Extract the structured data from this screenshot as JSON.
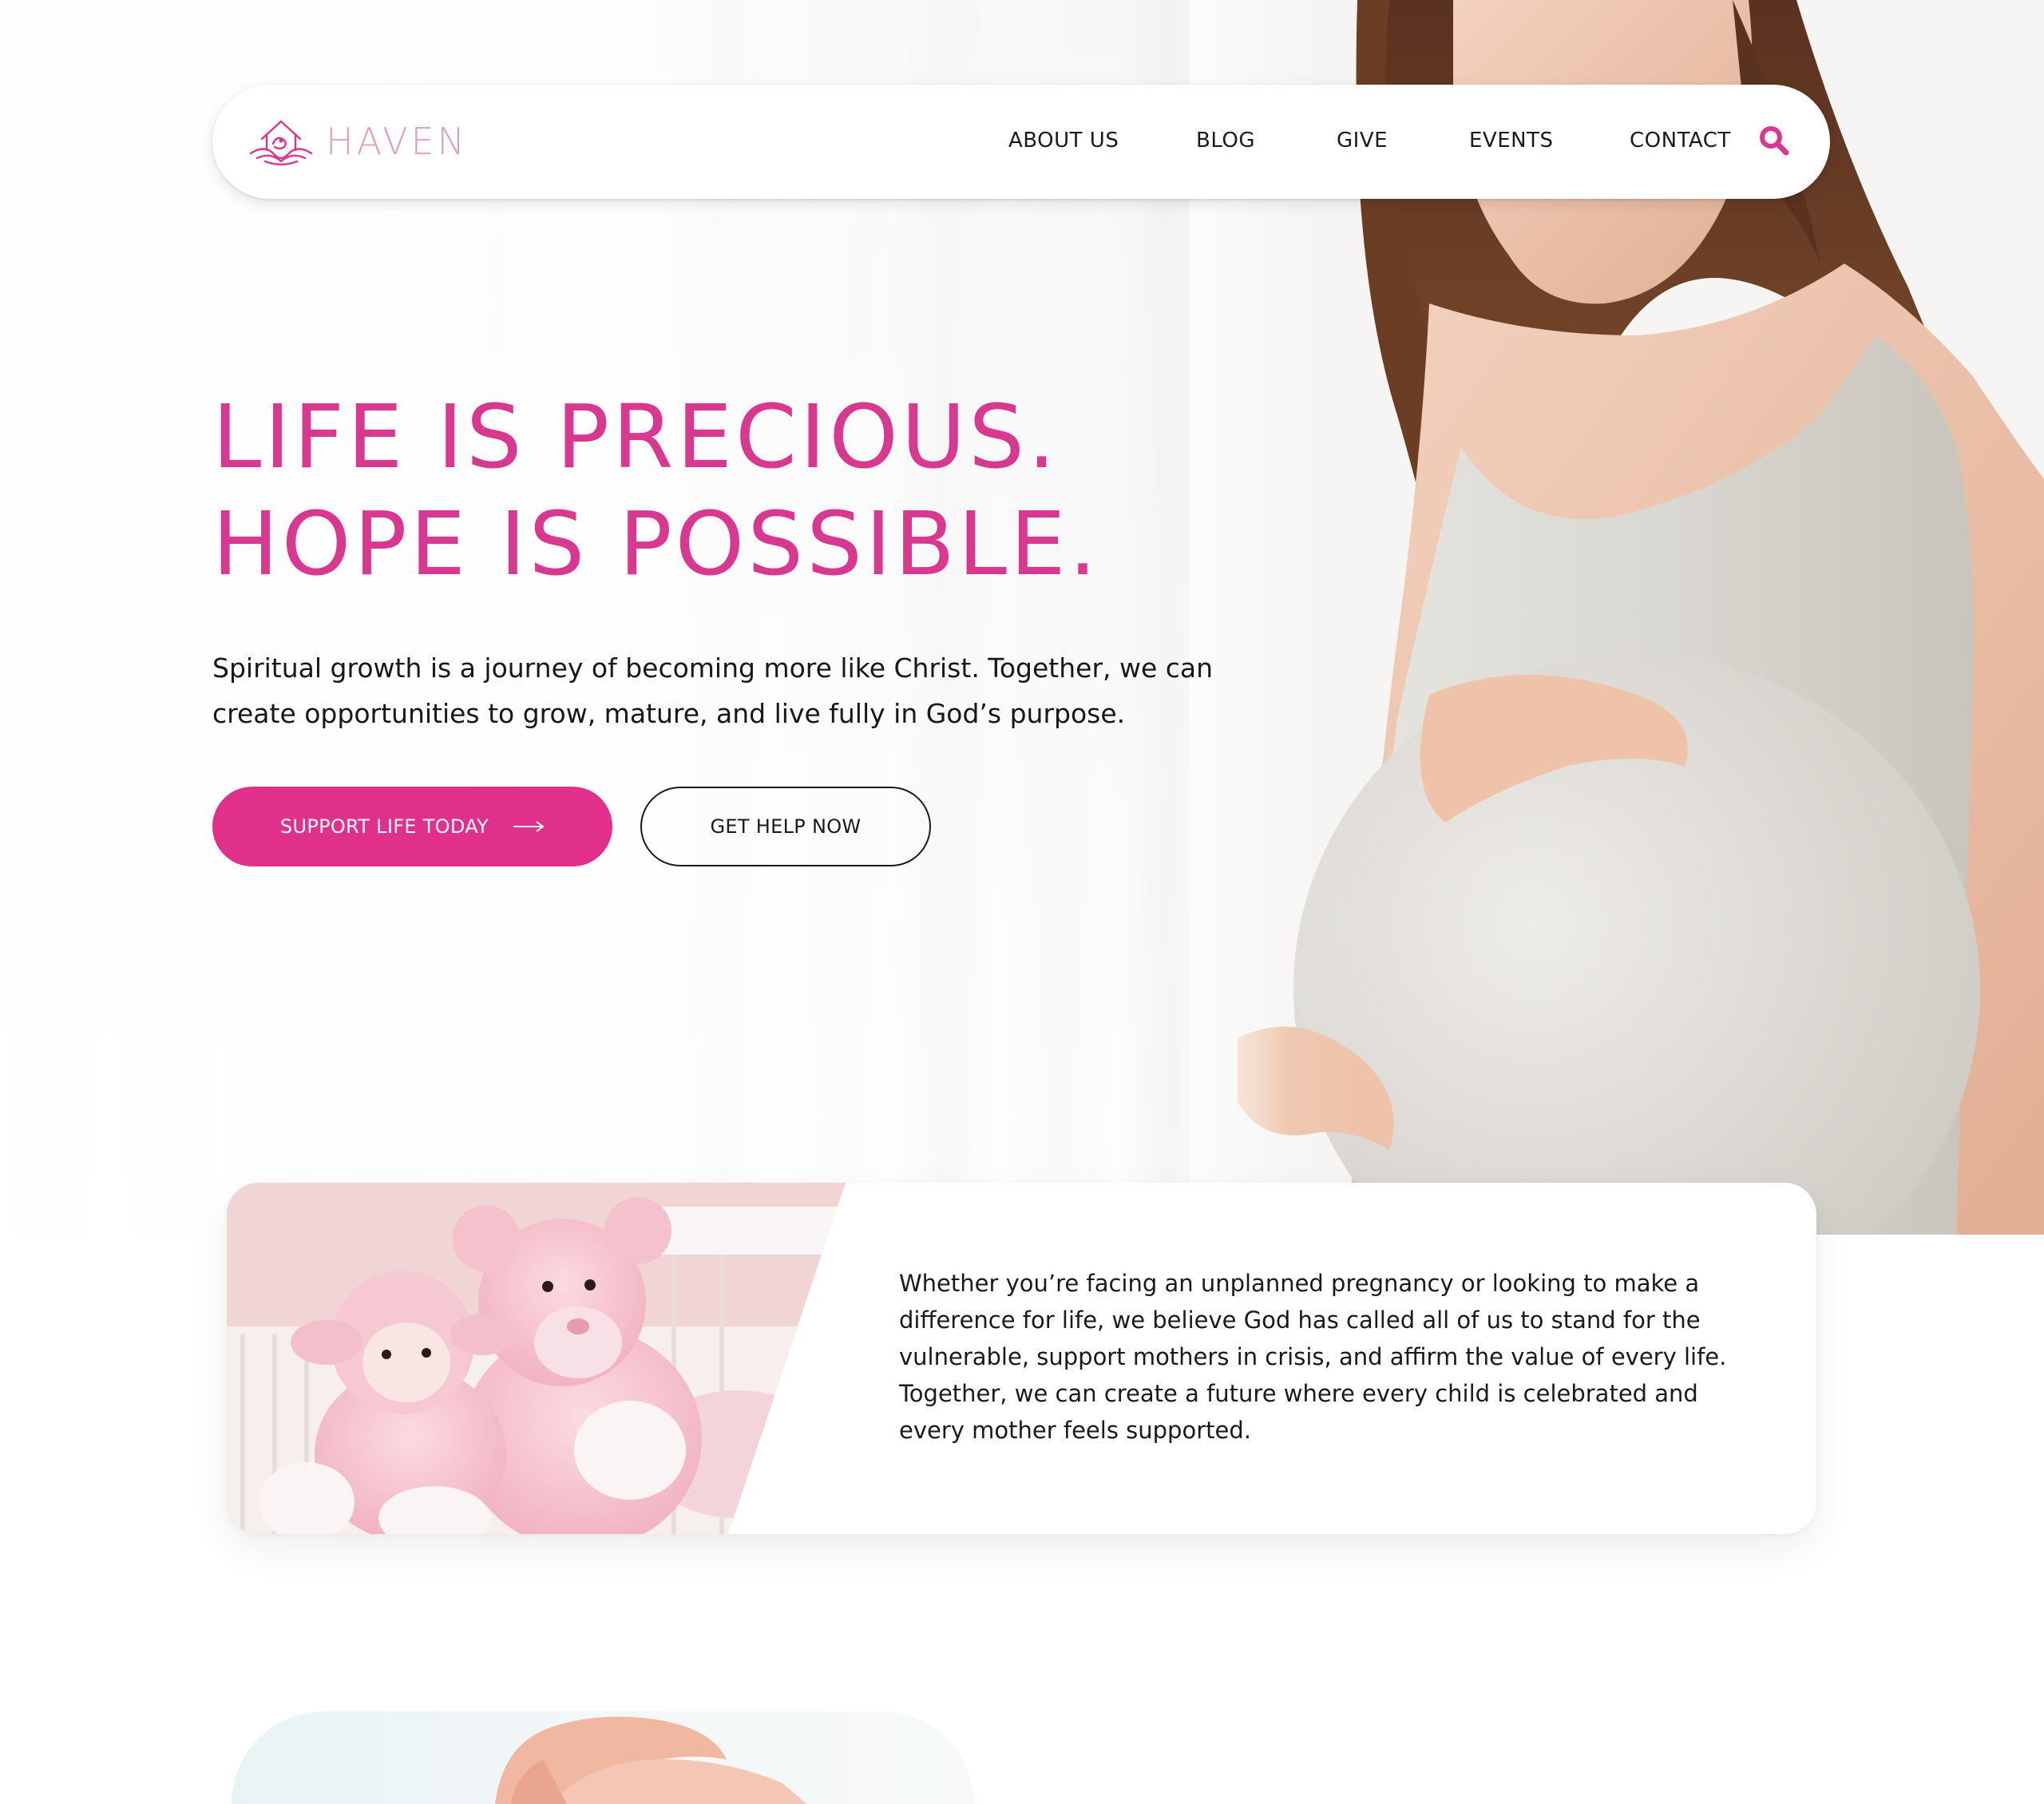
{
  "brand": {
    "name": "HAVEN",
    "accent_color": "#e0308b",
    "logo_color": "#dea0bf"
  },
  "nav": {
    "items": [
      {
        "label": "ABOUT US"
      },
      {
        "label": "BLOG"
      },
      {
        "label": "GIVE"
      },
      {
        "label": "EVENTS"
      },
      {
        "label": "CONTACT"
      }
    ],
    "search_icon": "search-icon"
  },
  "hero": {
    "title_line1": "LIFE IS PRECIOUS.",
    "title_line2": "HOPE IS POSSIBLE.",
    "subtitle": "Spiritual growth is a journey of becoming more like Christ. Together, we can create opportunities to grow, mature, and live fully in God’s purpose.",
    "primary_button": "SUPPORT LIFE TODAY",
    "secondary_button": "GET HELP NOW",
    "arrow_icon": "arrow-right-icon",
    "photo": "pregnant-woman-photo"
  },
  "info_card": {
    "photo": "pink-teddy-bears-photo",
    "text": "Whether you’re facing an unplanned pregnancy or looking to make a difference for life, we believe God has called all of us to stand for the vulnerable, support mothers in crisis, and affirm the value of every life. Together, we can create a future where every child is celebrated and every mother feels supported."
  },
  "bottom_section": {
    "photo": "hands-holding-baby-feet-photo"
  }
}
